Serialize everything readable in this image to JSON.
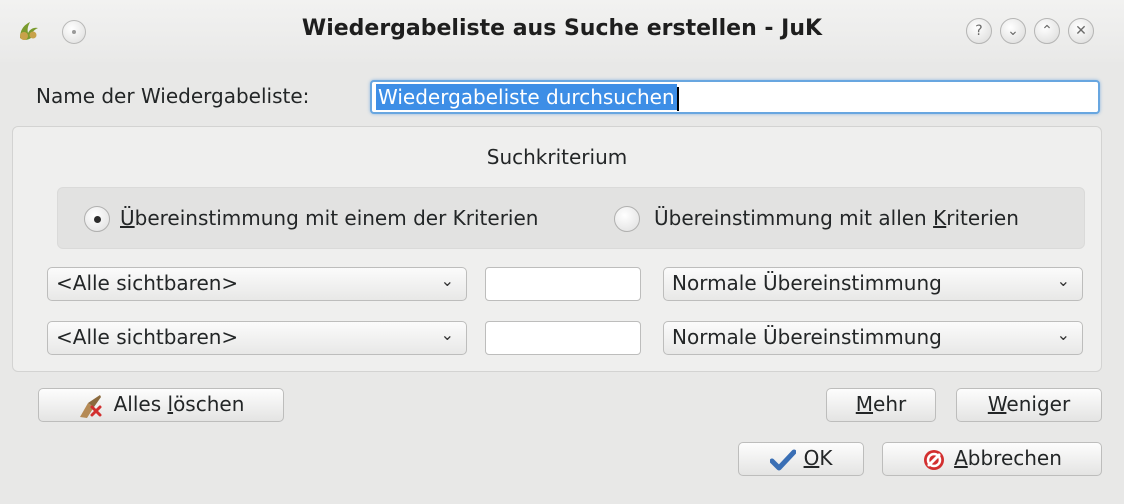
{
  "window": {
    "title": "Wiedergabeliste aus Suche erstellen - JuK",
    "buttons": [
      "?",
      "⌄",
      "⌃",
      "✕"
    ]
  },
  "name_row": {
    "label": "Name der Wiedergabeliste:",
    "value": "Wiedergabeliste durchsuchen"
  },
  "criteria": {
    "group_title": "Suchkriterium",
    "match_any": {
      "prefix": "",
      "u": "Ü",
      "rest": "bereinstimmung mit einem der Kriterien",
      "checked": true
    },
    "match_all": {
      "prefix": "Übereinstimmung mit allen ",
      "u": "K",
      "rest": "riterien",
      "checked": false
    },
    "rows": [
      {
        "field": "<Alle sichtbaren>",
        "text": "",
        "mode": "Normale Übereinstimmung"
      },
      {
        "field": "<Alle sichtbaren>",
        "text": "",
        "mode": "Normale Übereinstimmung"
      }
    ]
  },
  "actions": {
    "clear": {
      "u": "l",
      "prefix": "Alles ",
      "rest": "öschen"
    },
    "more": {
      "u": "M",
      "rest": "ehr"
    },
    "less": {
      "u": "W",
      "rest": "eniger"
    },
    "ok": {
      "u": "O",
      "rest": "K"
    },
    "cancel": {
      "u": "A",
      "rest": "bbrechen"
    }
  },
  "icons": {
    "app": "juk-icon",
    "clear": "broom-icon",
    "ok": "checkmark-icon",
    "cancel": "cancel-icon"
  },
  "colors": {
    "selection": "#3d8ee6",
    "focus_border": "#68a6e0",
    "cancel_icon": "#d22f2f",
    "ok_icon": "#3a6fb5"
  }
}
